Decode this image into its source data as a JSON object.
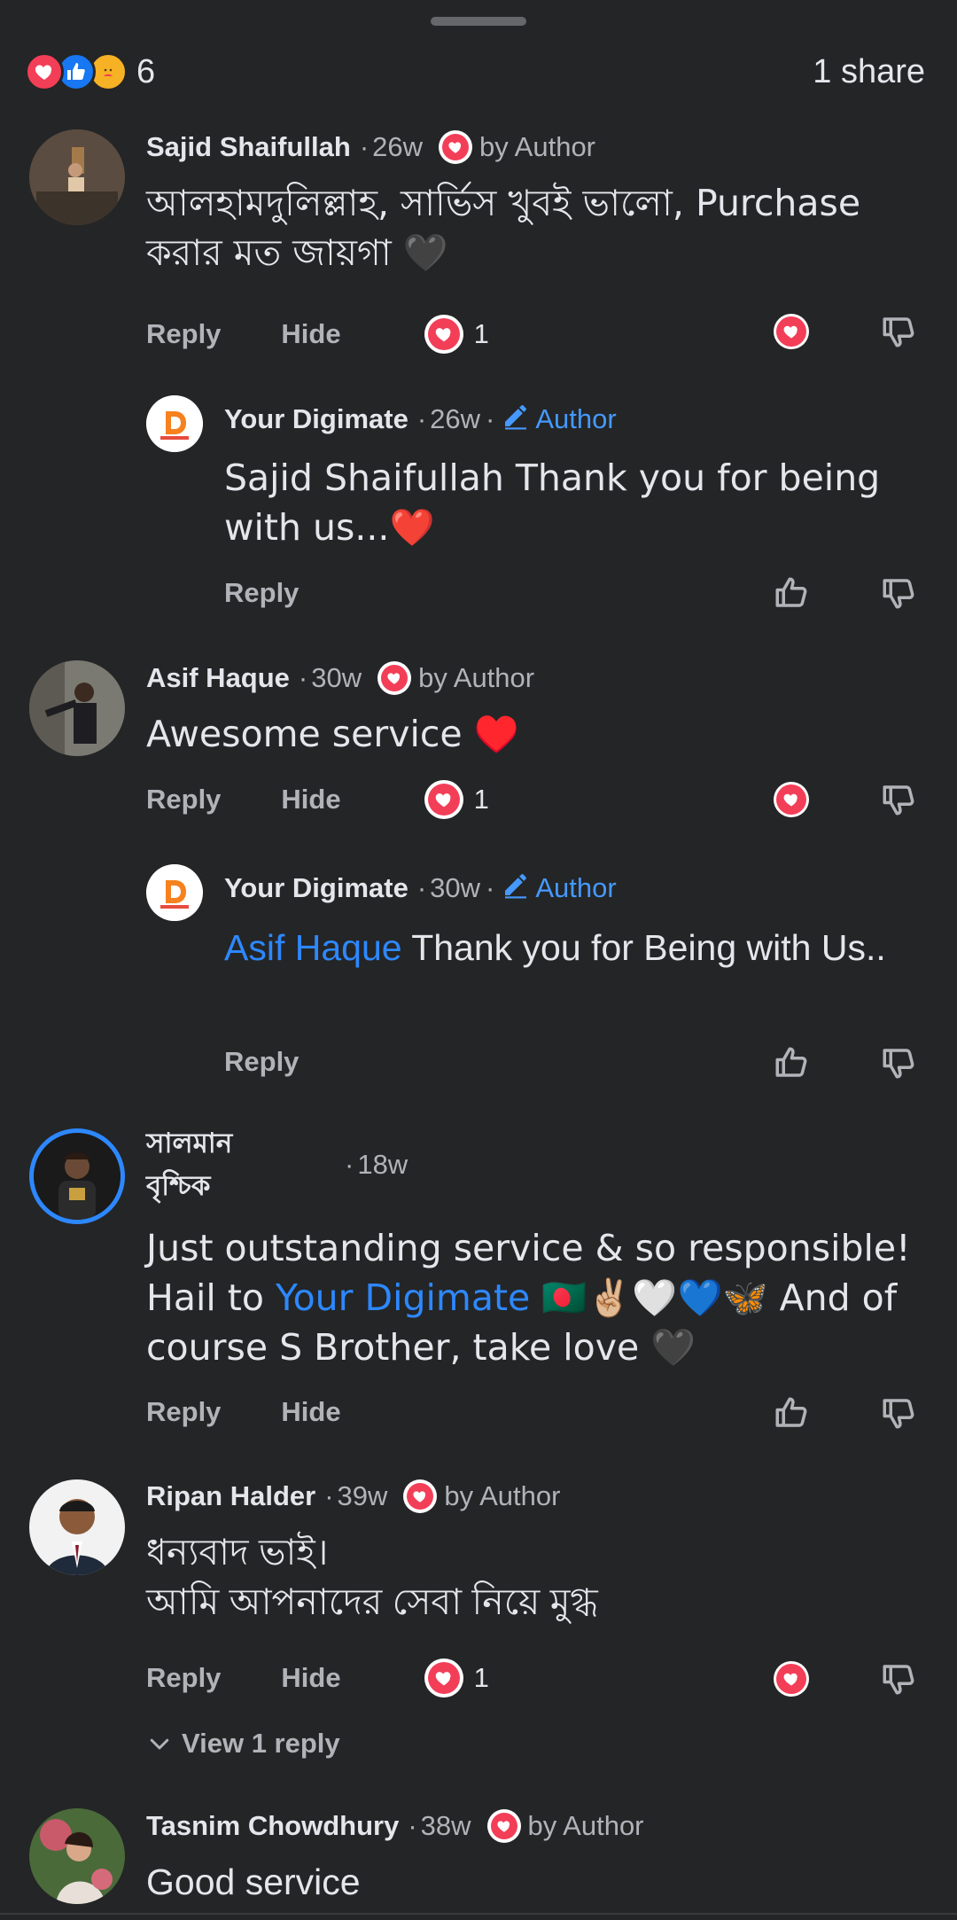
{
  "summary": {
    "reaction_count": "6",
    "shares": "1 share"
  },
  "labels": {
    "reply": "Reply",
    "hide": "Hide",
    "by_author": "by Author",
    "author": "Author",
    "dot": "·"
  },
  "comments": [
    {
      "name": "Sajid Shaifullah",
      "time": "26w",
      "text": "আলহামদুলিল্লাহ, সার্ভিস খুবই ভালো, Purchase করার মত জায়গা 🖤",
      "reaction_count": "1",
      "reply": {
        "name": "Your Digimate",
        "time": "26w",
        "text": "Sajid Shaifullah Thank you for being with us...❤️"
      }
    },
    {
      "name": "Asif Haque",
      "time": "30w",
      "text": "Awesome service ♥️",
      "reaction_count": "1",
      "reply": {
        "name": "Your Digimate",
        "time": "30w",
        "mention": "Asif Haque",
        "text": " Thank you for Being with Us.."
      }
    },
    {
      "name_line1": "সালমান",
      "name_line2": "বৃশ্চিক",
      "time": "18w",
      "text_before": "Just outstanding service & so responsible! Hail to ",
      "mention": "Your Digimate",
      "text_after": " 🇧🇩✌🏼🤍💙🦋  And of course S Brother, take love 🖤"
    },
    {
      "name": "Ripan Halder",
      "time": "39w",
      "text_line1": "ধন্যবাদ ভাই।",
      "text_line2": "আমি আপনাদের সেবা নিয়ে মুগ্ধ",
      "reaction_count": "1",
      "view_replies": "View 1 reply"
    },
    {
      "name": "Tasnim Chowdhury",
      "time": "38w",
      "text": "Good service"
    }
  ],
  "colors": {
    "background": "#242526",
    "love": "#f33e58",
    "like": "#1877f2",
    "mention": "#2d88ff",
    "author_tag": "#4599ff",
    "secondary_text": "#b0b3b8"
  },
  "icons": [
    "love-reaction",
    "like-reaction",
    "care-reaction",
    "heart-icon",
    "thumbs-up-icon",
    "thumbs-down-icon",
    "pencil-icon",
    "chevron-down-icon"
  ]
}
